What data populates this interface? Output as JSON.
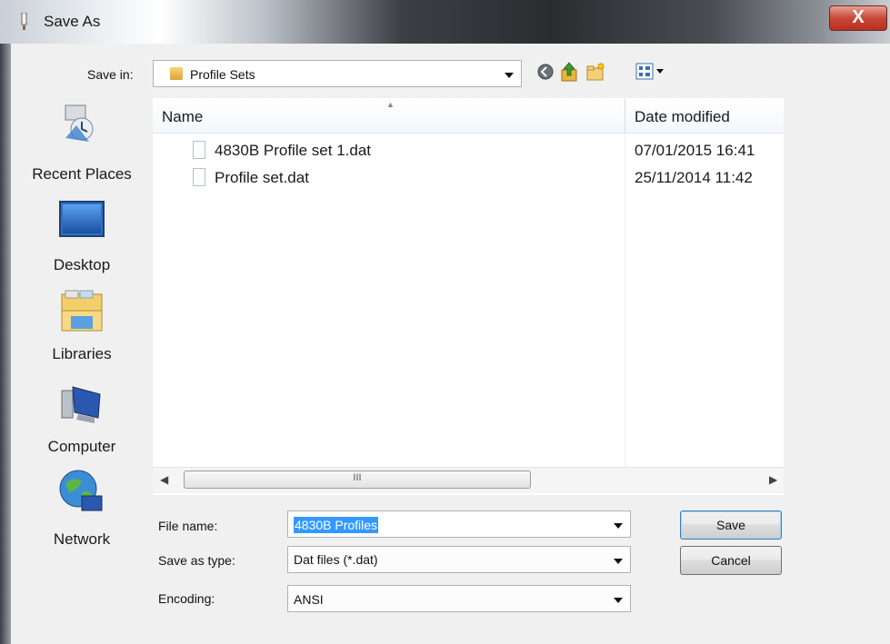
{
  "window": {
    "title": "Save As",
    "close_glyph": "X"
  },
  "save_in": {
    "label": "Save in:",
    "value": "Profile Sets"
  },
  "toolbar": {
    "icons": [
      "back-icon",
      "up-folder-icon",
      "new-folder-icon",
      "views-menu-icon"
    ]
  },
  "places": [
    {
      "name": "recent-places",
      "label": "Recent Places"
    },
    {
      "name": "desktop",
      "label": "Desktop"
    },
    {
      "name": "libraries",
      "label": "Libraries"
    },
    {
      "name": "computer",
      "label": "Computer"
    },
    {
      "name": "network",
      "label": "Network"
    }
  ],
  "list": {
    "columns": {
      "name": "Name",
      "date": "Date modified"
    },
    "rows": [
      {
        "name": "4830B Profile set 1.dat",
        "date": "07/01/2015 16:41"
      },
      {
        "name": "Profile set.dat",
        "date": "25/11/2014 11:42"
      }
    ],
    "scroll_grip": "III"
  },
  "form": {
    "file_name_label": "File name:",
    "file_name_value": "4830B Profiles",
    "save_type_label": "Save as type:",
    "save_type_value": "Dat files (*.dat)",
    "encoding_label": "Encoding:",
    "encoding_value": "ANSI"
  },
  "buttons": {
    "save": "Save",
    "cancel": "Cancel"
  },
  "colors": {
    "selection": "#3399ff",
    "dialog_bg": "#f0f0f0",
    "close_red": "#c8473a"
  }
}
